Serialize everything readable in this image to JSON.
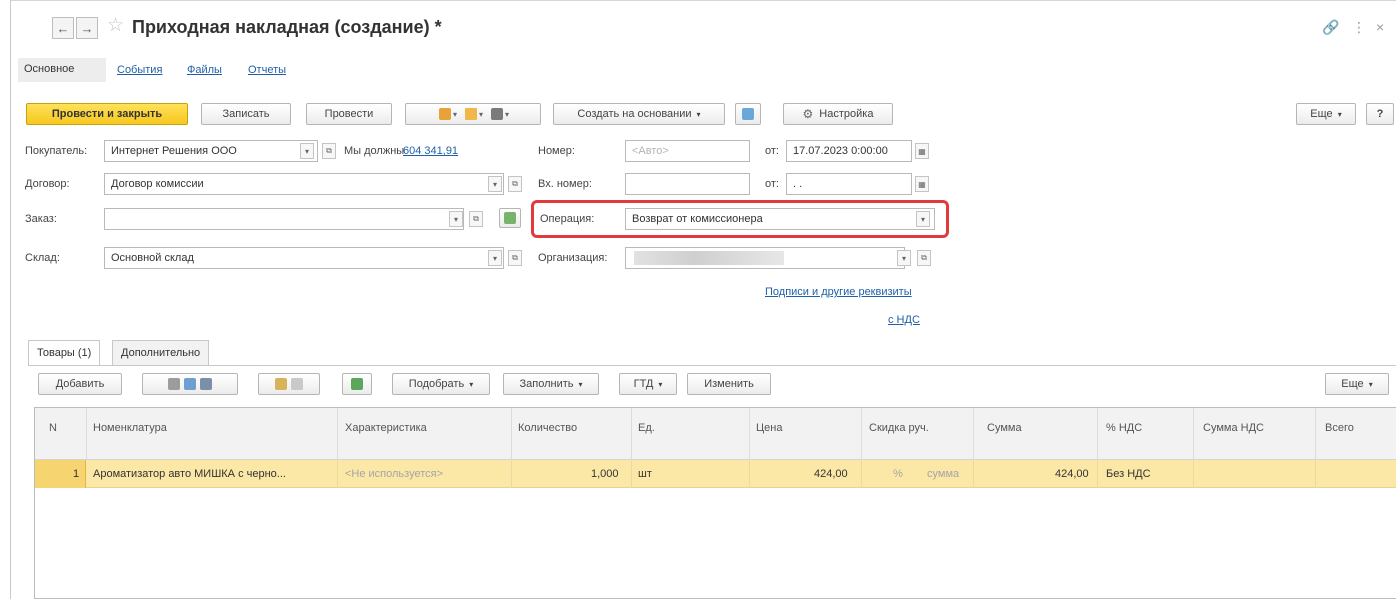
{
  "window": {
    "title": "Приходная накладная (создание) *"
  },
  "icons": {
    "back": "←",
    "forward": "→",
    "star": "☆",
    "link": "🔗",
    "more": "⋮",
    "close": "×",
    "dropdown": "▾",
    "open": "⧉",
    "calendar": "▦"
  },
  "sections": {
    "active": "Основное",
    "links": [
      "События",
      "Файлы",
      "Отчеты"
    ]
  },
  "toolbar": {
    "post_close": "Провести и закрыть",
    "save": "Записать",
    "post": "Провести",
    "create_based_on": "Создать на основании",
    "settings": "Настройка",
    "more": "Еще",
    "help": "?"
  },
  "form": {
    "buyer_label": "Покупатель:",
    "buyer_value": "Интернет Решения ООО",
    "debt_text": "Мы должны",
    "debt_amount": "604 341,91",
    "number_label": "Номер:",
    "number_placeholder": "<Авто>",
    "date_label": "от:",
    "date_value": "17.07.2023  0:00:00",
    "contract_label": "Договор:",
    "contract_value": "Договор комиссии",
    "in_number_label": "Вх. номер:",
    "in_date_label": "от:",
    "in_date_value": " .  .",
    "order_label": "Заказ:",
    "operation_label": "Операция:",
    "operation_value": "Возврат от комиссионера",
    "warehouse_label": "Склад:",
    "warehouse_value": "Основной склад",
    "org_label": "Организация:",
    "signatures_link": "Подписи и другие реквизиты",
    "vat_link": "с НДС"
  },
  "tabs": {
    "goods": "Товары (1)",
    "additional": "Дополнительно"
  },
  "table_toolbar": {
    "add": "Добавить",
    "pick": "Подобрать",
    "fill": "Заполнить",
    "gtd": "ГТД",
    "change": "Изменить",
    "more": "Еще"
  },
  "table": {
    "columns": [
      "N",
      "Номенклатура",
      "Характеристика",
      "Количество",
      "Ед.",
      "Цена",
      "Скидка руч.",
      "Сумма",
      "% НДС",
      "Сумма НДС",
      "Всего"
    ],
    "rows": [
      {
        "n": "1",
        "item": "Ароматизатор авто МИШКА с черно...",
        "characteristic": "<Не используется>",
        "qty": "1,000",
        "unit": "шт",
        "price": "424,00",
        "discount_pct": "%",
        "discount_sum": "сумма",
        "sum": "424,00",
        "vat_rate": "Без НДС",
        "vat_sum": "",
        "total": ""
      }
    ]
  },
  "colors": {
    "primary_button": "#f6c71e",
    "link": "#1f5fa8",
    "highlight_border": "#e03a3a",
    "selected_row": "#fbe8a6"
  }
}
